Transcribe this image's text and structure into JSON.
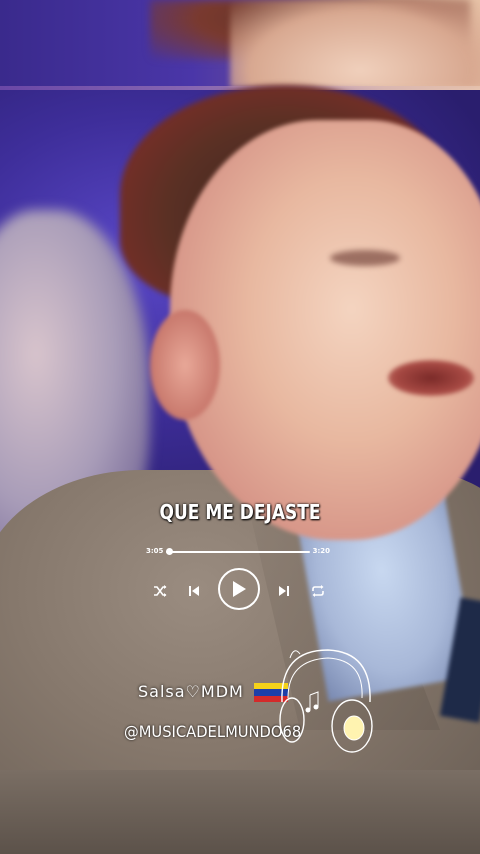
{
  "lyrics": {
    "current_line": "QUE ME DEJASTE"
  },
  "player": {
    "elapsed": "3:05",
    "duration": "3:20",
    "progress": 0.02,
    "icons": [
      "shuffle-icon",
      "previous-icon",
      "play-icon",
      "next-icon",
      "repeat-icon"
    ]
  },
  "credit": {
    "line1": "Salsa♡MDM",
    "handle": "@MUSICADELMUNDO68"
  },
  "colors": {
    "text": "#ffffff",
    "flag_yellow": "#f4d21a",
    "flag_blue": "#1d3fa8",
    "flag_red": "#d42a2a"
  }
}
